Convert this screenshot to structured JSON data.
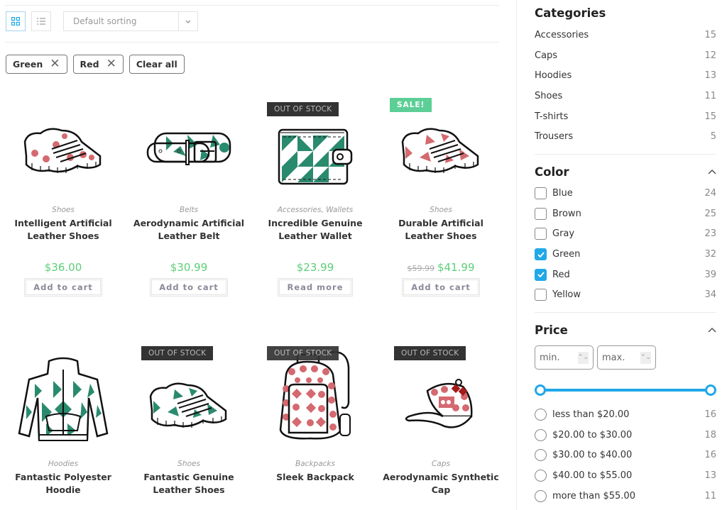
{
  "toolbar": {
    "grid_view_label": "Grid view",
    "list_view_label": "List view",
    "sort_selected": "Default sorting"
  },
  "active_filters": [
    {
      "label": "Green"
    },
    {
      "label": "Red"
    }
  ],
  "clear_all_label": "Clear all",
  "colors": {
    "accent": "#21a8e8",
    "price_green": "#5ccf78",
    "sale_badge": "#5ccf96",
    "oos_badge": "#333333",
    "pattern_red": "#d4696f",
    "pattern_green": "#2a8a6e"
  },
  "products": [
    {
      "category": "Shoes",
      "title": "Intelligent Artificial Leather Shoes",
      "price": "$36.00",
      "old_price": "",
      "button": "Add to cart",
      "badge": "",
      "icon": "sneaker-icon"
    },
    {
      "category": "Belts",
      "title": "Aerodynamic Artificial Leather Belt",
      "price": "$30.99",
      "old_price": "",
      "button": "Add to cart",
      "badge": "",
      "icon": "belt-icon"
    },
    {
      "category": "Accessories, Wallets",
      "title": "Incredible Genuine Leather Wallet",
      "price": "$23.99",
      "old_price": "",
      "button": "Read more",
      "badge": "OUT OF STOCK",
      "icon": "wallet-icon"
    },
    {
      "category": "Shoes",
      "title": "Durable Artificial Leather Shoes",
      "price": "$41.99",
      "old_price": "$59.99",
      "button": "Add to cart",
      "badge": "SALE!",
      "icon": "sneaker-icon"
    },
    {
      "category": "Hoodies",
      "title": "Fantastic Polyester Hoodie",
      "badge": "",
      "icon": "hoodie-icon"
    },
    {
      "category": "Shoes",
      "title": "Fantastic Genuine Leather Shoes",
      "badge": "OUT OF STOCK",
      "icon": "sneaker-icon"
    },
    {
      "category": "Backpacks",
      "title": "Sleek Backpack",
      "badge": "OUT OF STOCK",
      "icon": "backpack-icon"
    },
    {
      "category": "Caps",
      "title": "Aerodynamic Synthetic Cap",
      "badge": "OUT OF STOCK",
      "icon": "cap-icon"
    }
  ],
  "sidebar": {
    "categories": {
      "title": "Categories",
      "items": [
        {
          "label": "Accessories",
          "count": "15"
        },
        {
          "label": "Caps",
          "count": "12"
        },
        {
          "label": "Hoodies",
          "count": "13"
        },
        {
          "label": "Shoes",
          "count": "11"
        },
        {
          "label": "T-shirts",
          "count": "15"
        },
        {
          "label": "Trousers",
          "count": "5"
        }
      ]
    },
    "color": {
      "title": "Color",
      "items": [
        {
          "label": "Blue",
          "count": "24",
          "checked": false
        },
        {
          "label": "Brown",
          "count": "25",
          "checked": false
        },
        {
          "label": "Gray",
          "count": "23",
          "checked": false
        },
        {
          "label": "Green",
          "count": "32",
          "checked": true
        },
        {
          "label": "Red",
          "count": "39",
          "checked": true
        },
        {
          "label": "Yellow",
          "count": "34",
          "checked": false
        }
      ]
    },
    "price": {
      "title": "Price",
      "min_placeholder": "min.",
      "max_placeholder": "max.",
      "slider_range_fraction": [
        0,
        1
      ],
      "items": [
        {
          "label": "less than $20.00",
          "count": "16"
        },
        {
          "label": "$20.00 to $30.00",
          "count": "18"
        },
        {
          "label": "$30.00 to $40.00",
          "count": "16"
        },
        {
          "label": "$40.00 to $55.00",
          "count": "13"
        },
        {
          "label": "more than $55.00",
          "count": "11"
        }
      ]
    }
  }
}
